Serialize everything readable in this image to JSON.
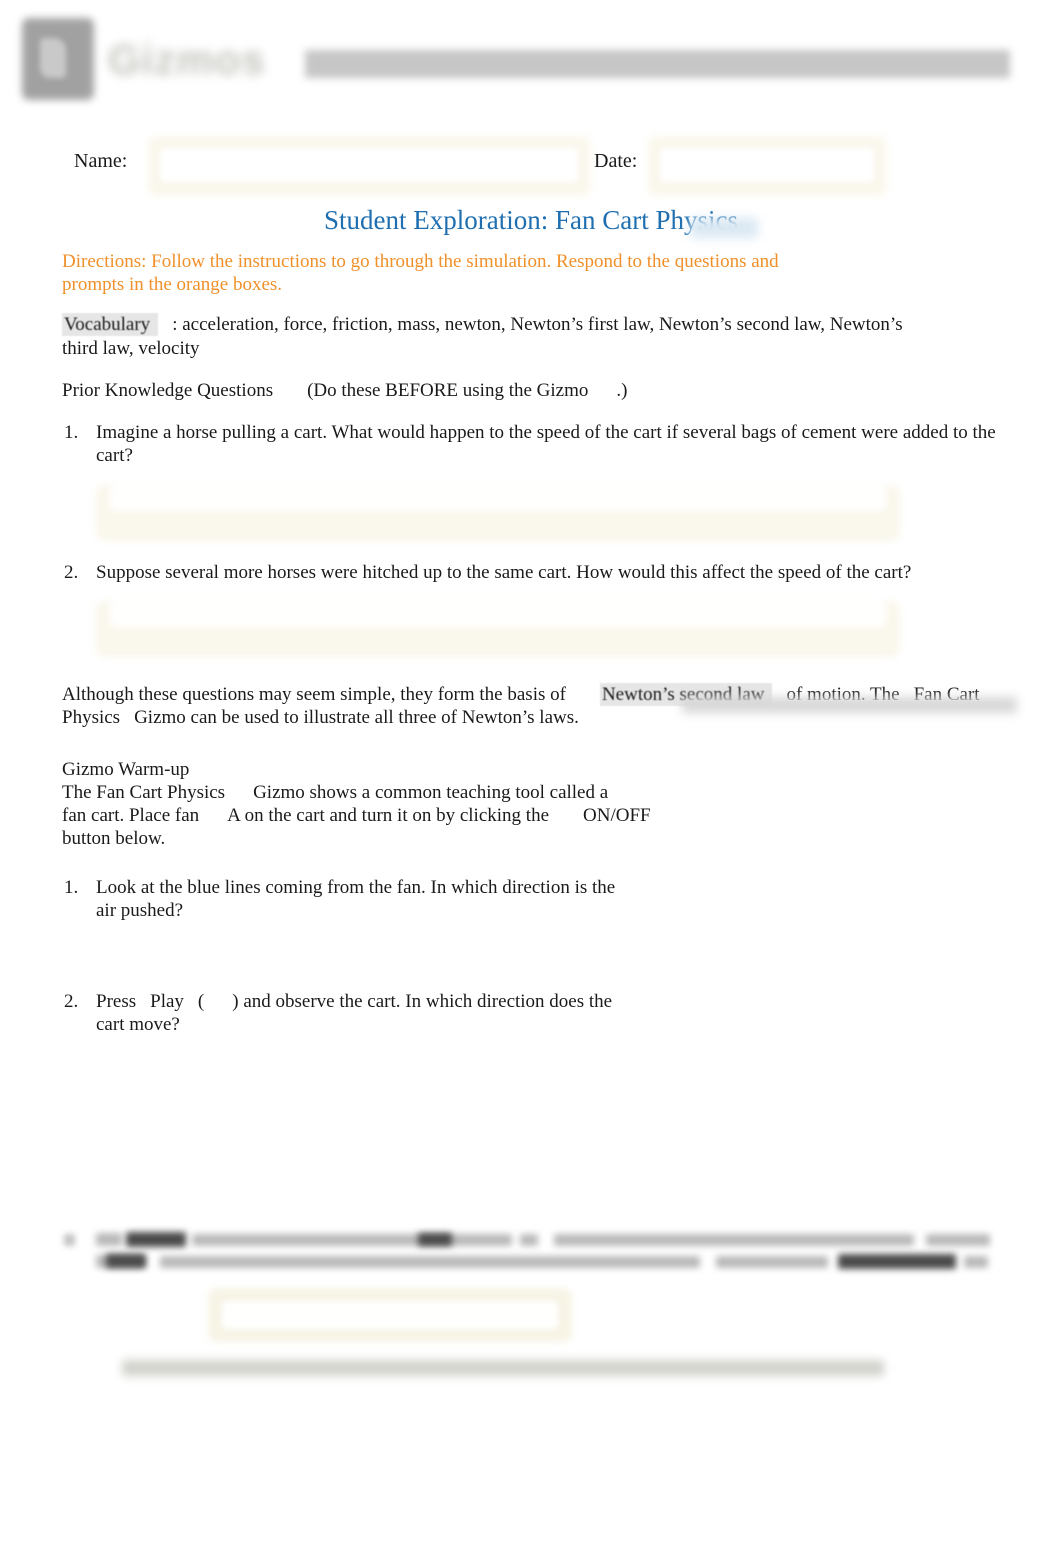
{
  "header": {
    "logo_name": "gizmos-logo-icon",
    "brand_text": "Gizmos",
    "redacted_bar_label": ""
  },
  "form": {
    "name_label": "Name:",
    "name_value": "",
    "name_placeholder": "",
    "date_label": "Date:",
    "date_value": "",
    "date_placeholder": ""
  },
  "title": "Student Exploration: Fan Cart Physics",
  "directions": "Directions: Follow the instructions to go through the simulation. Respond to the questions and prompts in the orange boxes.",
  "vocabulary": {
    "heading": "Vocabulary",
    "separator": ":",
    "terms": "acceleration, force, friction, mass, newton, Newton’s first law, Newton’s second law, Newton’s third law, velocity"
  },
  "prior_knowledge": {
    "heading": "Prior Knowledge Questions",
    "note_open": "(Do these BEFORE using the Gizmo",
    "note_close": ".)",
    "questions": [
      {
        "num": "1.",
        "text": "Imagine a horse pulling a cart. What would happen to the speed of the cart if several bags of cement were added to the cart?",
        "answer": ""
      },
      {
        "num": "2.",
        "text": "Suppose several more horses were hitched up to the same cart. How would this affect the speed of the cart?",
        "answer": ""
      }
    ]
  },
  "basis_paragraph": {
    "part1": "Although these questions may seem simple, they form the basis of",
    "highlight": "Newton’s second law",
    "part2": "of motion. The",
    "gizmo1": "Fan",
    "gizmo2": "Cart Physics",
    "part3": "Gizmo can be used to illustrate all three of Newton’s laws."
  },
  "warm_up": {
    "heading": "Gizmo Warm-up",
    "line1_a": "The",
    "line1_gizmo": "Fan Cart Physics",
    "line1_b": "Gizmo shows a common teaching tool called a",
    "line2_a": "fan cart. Place fan",
    "line2_b": "A on the cart and turn it on by clicking the",
    "line2_onoff": "ON/OFF",
    "line3": "button below.",
    "questions": [
      {
        "num": "1.",
        "text_a": "Look at the blue lines coming from the fan. In which direction is the",
        "text_b": "air pushed?"
      },
      {
        "num": "2.",
        "text_a": "Press",
        "text_play": "Play",
        "text_paren_open": "(",
        "text_paren_close": ")",
        "text_b": "and observe the cart. In which direction does the",
        "text_c": "cart move?"
      }
    ]
  },
  "bottom_redacted": {
    "note": "redacted-blurred-question",
    "answer": ""
  },
  "footer_redacted": {
    "note": "redacted-blurred-footer"
  },
  "colors": {
    "title_blue": "#1f6fb0",
    "directions_orange": "#f0902a",
    "answer_box_cream": "#faf7ec",
    "highlight_grey": "#e6e6e6",
    "page_background": "#ffffff",
    "text": "#1a1a1a"
  }
}
